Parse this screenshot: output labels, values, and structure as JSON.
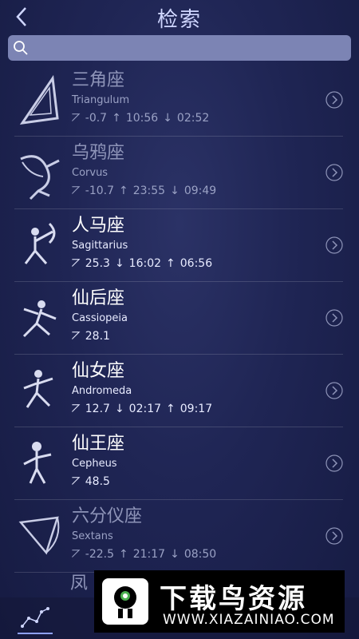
{
  "header": {
    "title": "检索",
    "back_icon": "chevron-left-icon"
  },
  "search": {
    "placeholder": "",
    "icon": "search-icon"
  },
  "rows": [
    {
      "cn": "三角座",
      "en": "Triangulum",
      "alt": "-0.7",
      "t1_dir": "↑",
      "t1": "10:56",
      "t2_dir": "↓",
      "t2": "02:52",
      "dim": true
    },
    {
      "cn": "乌鸦座",
      "en": "Corvus",
      "alt": "-10.7",
      "t1_dir": "↑",
      "t1": "23:55",
      "t2_dir": "↓",
      "t2": "09:49",
      "dim": true
    },
    {
      "cn": "人马座",
      "en": "Sagittarius",
      "alt": "25.3",
      "t1_dir": "↓",
      "t1": "16:02",
      "t2_dir": "↑",
      "t2": "06:56",
      "dim": false
    },
    {
      "cn": "仙后座",
      "en": "Cassiopeia",
      "alt": "28.1",
      "t1_dir": "",
      "t1": "",
      "t2_dir": "",
      "t2": "",
      "dim": false
    },
    {
      "cn": "仙女座",
      "en": "Andromeda",
      "alt": "12.7",
      "t1_dir": "↓",
      "t1": "02:17",
      "t2_dir": "↑",
      "t2": "09:17",
      "dim": false
    },
    {
      "cn": "仙王座",
      "en": "Cepheus",
      "alt": "48.5",
      "t1_dir": "",
      "t1": "",
      "t2_dir": "",
      "t2": "",
      "dim": false
    },
    {
      "cn": "六分仪座",
      "en": "Sextans",
      "alt": "-22.5",
      "t1_dir": "↑",
      "t1": "21:17",
      "t2_dir": "↓",
      "t2": "08:50",
      "dim": true
    }
  ],
  "partial_row": {
    "cn": "凤"
  },
  "banner": {
    "title": "下载鸟资源",
    "url": "WWW.XIAZAINIAO.COM"
  },
  "colors": {
    "background": "#1f2554",
    "search": "#7c84b4",
    "dim_text": "#8e94b8"
  }
}
